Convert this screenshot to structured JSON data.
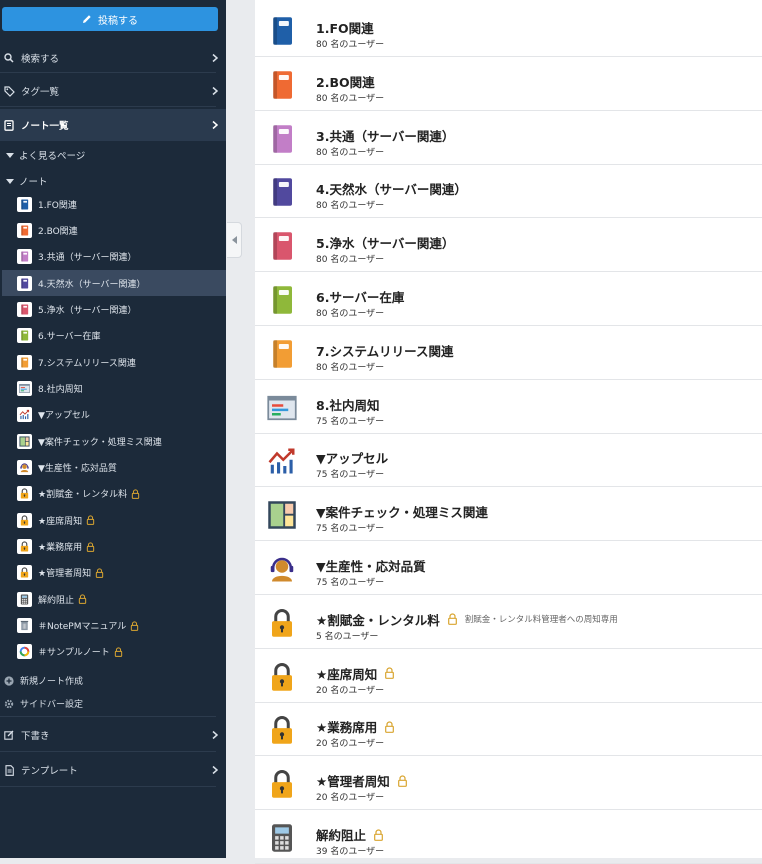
{
  "colors": {
    "sidebar_bg": "#1c2a3a",
    "post_button": "#2d93e0",
    "lock_gold": "#d9a530"
  },
  "sidebar": {
    "post_button_label": "投稿する",
    "search_label": "検索する",
    "tags_label": "タグ一覧",
    "notes_list_label": "ノート一覧",
    "frequent_pages_label": "よく見るページ",
    "notes_label": "ノート",
    "items": [
      {
        "label": "1.FO関連",
        "icon": "book-icon",
        "color": "#1f5fa8",
        "locked": false
      },
      {
        "label": "2.BO関連",
        "icon": "book-icon",
        "color": "#ef6a33",
        "locked": false
      },
      {
        "label": "3.共通（サーバー関連）",
        "icon": "book-icon",
        "color": "#c27ec7",
        "locked": false
      },
      {
        "label": "4.天然水（サーバー関連）",
        "icon": "book-icon",
        "color": "#51499e",
        "locked": false
      },
      {
        "label": "5.浄水（サーバー関連）",
        "icon": "book-icon",
        "color": "#d9566d",
        "locked": false
      },
      {
        "label": "6.サーバー在庫",
        "icon": "book-icon",
        "color": "#8fb83a",
        "locked": false
      },
      {
        "label": "7.システムリリース関連",
        "icon": "book-icon",
        "color": "#f29d34",
        "locked": false
      },
      {
        "label": "8.社内周知",
        "icon": "window-icon",
        "color": "#7a8a9a",
        "locked": false
      },
      {
        "label": "▼アップセル",
        "icon": "chart-icon",
        "color": "#c0392b",
        "locked": false
      },
      {
        "label": "▼案件チェック・処理ミス関連",
        "icon": "board-icon",
        "color": "#33475b",
        "locked": false
      },
      {
        "label": "▼生産性・応対品質",
        "icon": "headset-icon",
        "color": "#d08a2c",
        "locked": false
      },
      {
        "label": "★割賦金・レンタル料",
        "icon": "padlock-icon",
        "color": "#f0a51a",
        "locked": true
      },
      {
        "label": "★座席周知",
        "icon": "padlock-icon",
        "color": "#f0a51a",
        "locked": true
      },
      {
        "label": "★業務席用",
        "icon": "padlock-icon",
        "color": "#f0a51a",
        "locked": true
      },
      {
        "label": "★管理者周知",
        "icon": "padlock-icon",
        "color": "#f0a51a",
        "locked": true
      },
      {
        "label": "解約阻止",
        "icon": "calculator-icon",
        "color": "#555555",
        "locked": true
      },
      {
        "label": "＃NotePMマニュアル",
        "icon": "trash-doc-icon",
        "color": "#555555",
        "locked": true
      },
      {
        "label": "＃サンプルノート",
        "icon": "ring-icon",
        "color": "#f4b400",
        "locked": true
      }
    ],
    "new_note_label": "新規ノート作成",
    "sidebar_settings_label": "サイドバー設定",
    "drafts_label": "下書き",
    "templates_label": "テンプレート"
  },
  "notes": [
    {
      "title": "1.FO関連",
      "users": "80 名のユーザー",
      "icon": "book-icon",
      "color": "#1f5fa8",
      "locked": false,
      "note": ""
    },
    {
      "title": "2.BO関連",
      "users": "80 名のユーザー",
      "icon": "book-icon",
      "color": "#ef6a33",
      "locked": false,
      "note": ""
    },
    {
      "title": "3.共通（サーバー関連）",
      "users": "80 名のユーザー",
      "icon": "book-icon",
      "color": "#c27ec7",
      "locked": false,
      "note": ""
    },
    {
      "title": "4.天然水（サーバー関連）",
      "users": "80 名のユーザー",
      "icon": "book-icon",
      "color": "#51499e",
      "locked": false,
      "note": ""
    },
    {
      "title": "5.浄水（サーバー関連）",
      "users": "80 名のユーザー",
      "icon": "book-icon",
      "color": "#d9566d",
      "locked": false,
      "note": ""
    },
    {
      "title": "6.サーバー在庫",
      "users": "80 名のユーザー",
      "icon": "book-icon",
      "color": "#8fb83a",
      "locked": false,
      "note": ""
    },
    {
      "title": "7.システムリリース関連",
      "users": "80 名のユーザー",
      "icon": "book-icon",
      "color": "#f29d34",
      "locked": false,
      "note": ""
    },
    {
      "title": "8.社内周知",
      "users": "75 名のユーザー",
      "icon": "window-icon",
      "color": "#7a8a9a",
      "locked": false,
      "note": ""
    },
    {
      "title": "▼アップセル",
      "users": "75 名のユーザー",
      "icon": "chart-icon",
      "color": "#c0392b",
      "locked": false,
      "note": ""
    },
    {
      "title": "▼案件チェック・処理ミス関連",
      "users": "75 名のユーザー",
      "icon": "board-icon",
      "color": "#33475b",
      "locked": false,
      "note": ""
    },
    {
      "title": "▼生産性・応対品質",
      "users": "75 名のユーザー",
      "icon": "headset-icon",
      "color": "#d08a2c",
      "locked": false,
      "note": ""
    },
    {
      "title": "★割賦金・レンタル料",
      "users": "5 名のユーザー",
      "icon": "padlock-icon",
      "color": "#f0a51a",
      "locked": true,
      "note": "割賦金・レンタル料管理者への周知専用"
    },
    {
      "title": "★座席周知",
      "users": "20 名のユーザー",
      "icon": "padlock-icon",
      "color": "#f0a51a",
      "locked": true,
      "note": ""
    },
    {
      "title": "★業務席用",
      "users": "20 名のユーザー",
      "icon": "padlock-icon",
      "color": "#f0a51a",
      "locked": true,
      "note": ""
    },
    {
      "title": "★管理者周知",
      "users": "20 名のユーザー",
      "icon": "padlock-icon",
      "color": "#f0a51a",
      "locked": true,
      "note": ""
    },
    {
      "title": "解約阻止",
      "users": "39 名のユーザー",
      "icon": "calculator-icon",
      "color": "#555555",
      "locked": true,
      "note": ""
    }
  ]
}
